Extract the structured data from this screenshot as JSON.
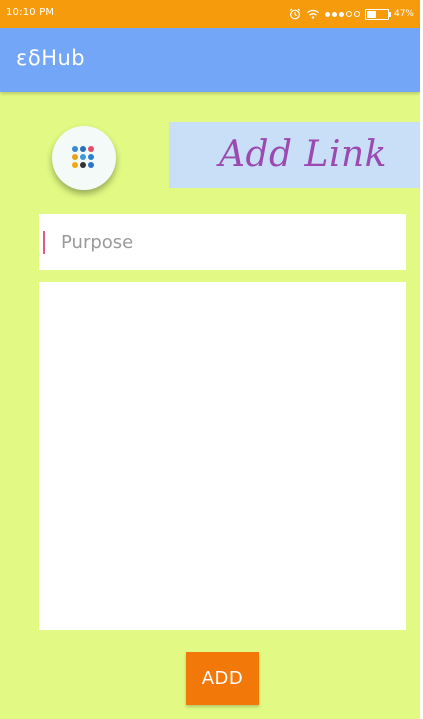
{
  "status_bar": {
    "time": "10:10 PM",
    "battery_pct": "47%",
    "battery_level": 0.47,
    "icons": [
      "alarm-icon",
      "wifi-icon",
      "signal-icon",
      "battery-icon"
    ]
  },
  "app_bar": {
    "title": "εδHub"
  },
  "menu_button": {
    "icon": "grid-dots-icon",
    "dot_colors": [
      "#3a88d8",
      "#2a6ec0",
      "#e64b6b",
      "#e6a21a",
      "#3b9ad9",
      "#2f7fcf",
      "#f0a818",
      "#333333",
      "#2c73c9"
    ]
  },
  "header": {
    "title": "Add Link"
  },
  "form": {
    "purpose_placeholder": "Purpose",
    "purpose_value": "",
    "body_value": ""
  },
  "actions": {
    "add_label": "ADD"
  },
  "colors": {
    "background": "#e2fa83",
    "status_bar": "#f59b0c",
    "app_bar": "#74a6f7",
    "header_card": "#c9def7",
    "header_text": "#9a4ab0",
    "add_button": "#f2780a",
    "cursor": "#e05b86"
  }
}
